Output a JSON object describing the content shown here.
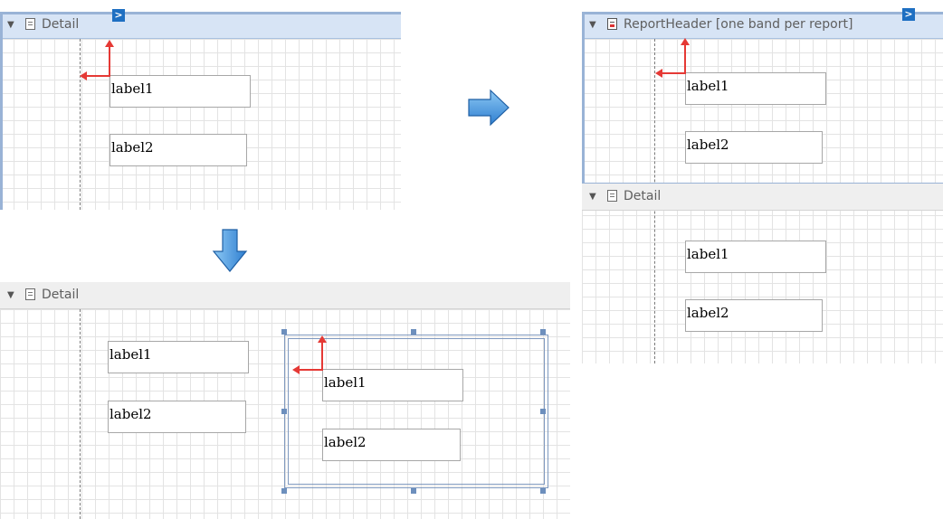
{
  "panels": {
    "top_left": {
      "band_title": "Detail",
      "smart_tag": ">",
      "labels": [
        "label1",
        "label2"
      ]
    },
    "right": {
      "report_header_title": "ReportHeader [one band per report]",
      "smart_tag": ">",
      "header_labels": [
        "label1",
        "label2"
      ],
      "detail_title": "Detail",
      "detail_labels": [
        "label1",
        "label2"
      ]
    },
    "bottom": {
      "band_title": "Detail",
      "labels": [
        "label1",
        "label2"
      ],
      "panel_labels": [
        "label1",
        "label2"
      ]
    }
  },
  "colors": {
    "selected_band": "#d7e4f5",
    "band": "#efefef",
    "guide_arrow": "#e53935",
    "flow_arrow": "#3a8fdc",
    "smart_tag": "#1e6fc2"
  },
  "icons": {
    "expand": "triangle-down-icon",
    "band": "detail-band-icon",
    "report_header": "report-header-icon",
    "smart_tag": "smart-tag-icon"
  }
}
